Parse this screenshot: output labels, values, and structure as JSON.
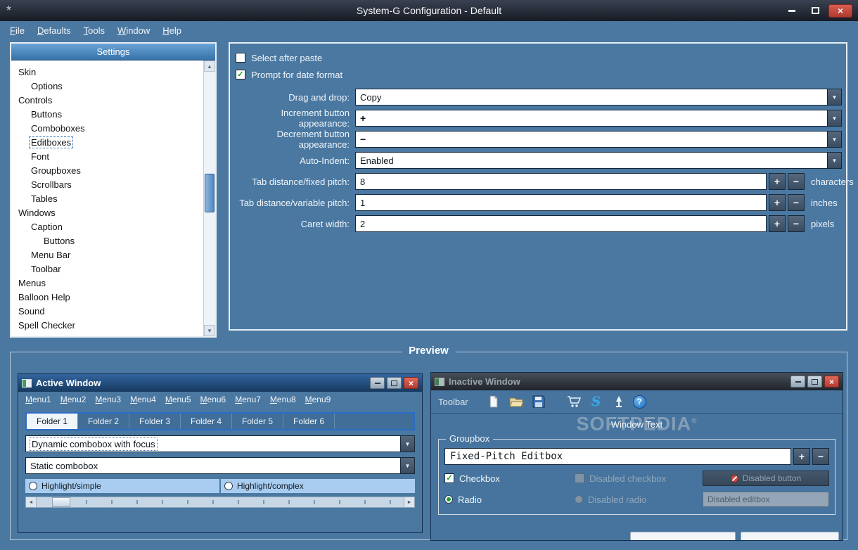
{
  "titlebar": {
    "title": "System-G Configuration - Default"
  },
  "menubar": {
    "items": [
      {
        "label": "File"
      },
      {
        "label": "Defaults"
      },
      {
        "label": "Tools"
      },
      {
        "label": "Window"
      },
      {
        "label": "Help"
      }
    ]
  },
  "settings": {
    "header": "Settings",
    "selected": "Editboxes",
    "items": [
      {
        "label": "Skin"
      },
      {
        "label": "Options"
      },
      {
        "label": "Controls"
      },
      {
        "label": "Buttons"
      },
      {
        "label": "Comboboxes"
      },
      {
        "label": "Editboxes"
      },
      {
        "label": "Font"
      },
      {
        "label": "Groupboxes"
      },
      {
        "label": "Scrollbars"
      },
      {
        "label": "Tables"
      },
      {
        "label": "Windows"
      },
      {
        "label": "Caption"
      },
      {
        "label": "Buttons"
      },
      {
        "label": "Menu Bar"
      },
      {
        "label": "Toolbar"
      },
      {
        "label": "Menus"
      },
      {
        "label": "Balloon Help"
      },
      {
        "label": "Sound"
      },
      {
        "label": "Spell Checker"
      }
    ]
  },
  "form": {
    "select_after_paste": {
      "label": "Select after paste",
      "checked": false
    },
    "prompt_date_format": {
      "label": "Prompt for date format",
      "checked": true
    },
    "drag_drop": {
      "label": "Drag and drop:",
      "value": "Copy"
    },
    "increment": {
      "label": "Increment button appearance:",
      "value": "+"
    },
    "decrement": {
      "label": "Decrement button appearance:",
      "value": "−"
    },
    "auto_indent": {
      "label": "Auto-Indent:",
      "value": "Enabled"
    },
    "tab_fixed": {
      "label": "Tab distance/fixed pitch:",
      "value": "8",
      "unit": "characters"
    },
    "tab_variable": {
      "label": "Tab distance/variable pitch:",
      "value": "1",
      "unit": "inches"
    },
    "caret_width": {
      "label": "Caret width:",
      "value": "2",
      "unit": "pixels"
    }
  },
  "preview": {
    "legend": "Preview",
    "active_window": {
      "title": "Active Window",
      "menus": [
        "Menu1",
        "Menu2",
        "Menu3",
        "Menu4",
        "Menu5",
        "Menu6",
        "Menu7",
        "Menu8",
        "Menu9"
      ],
      "tabs": [
        "Folder 1",
        "Folder 2",
        "Folder 3",
        "Folder 4",
        "Folder 5",
        "Folder 6"
      ],
      "active_tab": "Folder 1",
      "combobox_focus": "Dynamic combobox with focus",
      "combobox_static": "Static combobox",
      "radio_simple": "Highlight/simple",
      "radio_complex": "Highlight/complex"
    },
    "inactive_window": {
      "title": "Inactive Window",
      "toolbar_label": "Toolbar",
      "window_text": "Window Text",
      "watermark": "SOFTPEDIA",
      "watermark_reg": "®",
      "groupbox_label": "Groupbox",
      "editbox_value": "Fixed-Pitch Editbox",
      "checkbox_label": "Checkbox",
      "disabled_checkbox_label": "Disabled checkbox",
      "disabled_button_label": "Disabled button",
      "radio_label": "Radio",
      "disabled_radio_label": "Disabled radio",
      "disabled_editbox_value": "Disabled editbox"
    }
  },
  "icons": {
    "app": "*",
    "close": "×",
    "check": "✓",
    "dropdown": "▼",
    "plus": "+",
    "minus": "−",
    "scroll_up": "▲",
    "scroll_down": "▼",
    "left": "◄",
    "right": "►",
    "s_logo": "S",
    "help": "?"
  }
}
